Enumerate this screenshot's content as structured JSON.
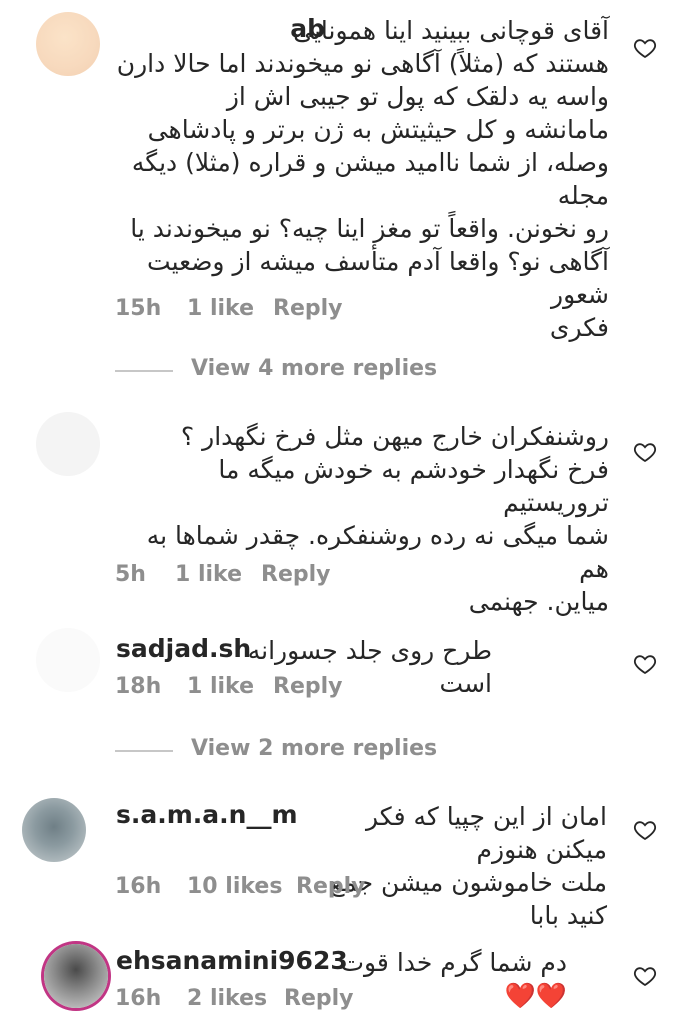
{
  "comments": [
    {
      "username": "ab",
      "lines": [
        "آقای قوچانی ببینید اینا همونایی",
        "هستند که (مثلاً) آگاهی نو میخوندند اما حالا دارن",
        "واسه یه دلقک که پول تو جیبی اش از",
        "مامانشه و کل حیثیتش به ژن برتر و پادشاهی",
        "وصله، از شما ناامید میشن و قراره (مثلا) دیگه مجله",
        "رو نخونن. واقعاً تو مغز اینا چیه؟ نو میخوندند یا",
        "آگاهی نو؟ واقعا آدم متأسف میشه از وضعیت شعور",
        "فکری"
      ],
      "time": "15h",
      "likes": "1 like",
      "reply": "Reply"
    },
    {
      "username": "",
      "lines": [
        "روشنفکران خارج میهن مثل فرخ نگهدار ؟",
        "فرخ نگهدار خودشم به خودش میگه ما تروریستیم",
        "شما میگی نه رده روشنفکره. چقدر شماها به هم",
        "میاین. جهنمی"
      ],
      "time": "5h",
      "likes": "1 like",
      "reply": "Reply"
    },
    {
      "username": "sadjad.sh",
      "lines": [
        "طرح روی جلد جسورانه است"
      ],
      "time": "18h",
      "likes": "1 like",
      "reply": "Reply"
    },
    {
      "username": "s.a.m.a.n__m",
      "lines": [
        "امان از این چپیا که فکر میکنن هنوزم",
        "ملت خاموشون میشن جمع کنید بابا"
      ],
      "time": "16h",
      "likes": "10 likes",
      "reply": "Reply"
    },
    {
      "username": "ehsanamini9623",
      "lines": [
        "دم شما گرم خدا قوت ❤️❤️"
      ],
      "time": "16h",
      "likes": "2 likes",
      "reply": "Reply"
    }
  ],
  "view_more": [
    "View 4 more replies",
    "View 2 more replies"
  ],
  "colors": {
    "text": "#262626",
    "secondary": "#8e8e8e",
    "divider": "#c7c7c7"
  }
}
